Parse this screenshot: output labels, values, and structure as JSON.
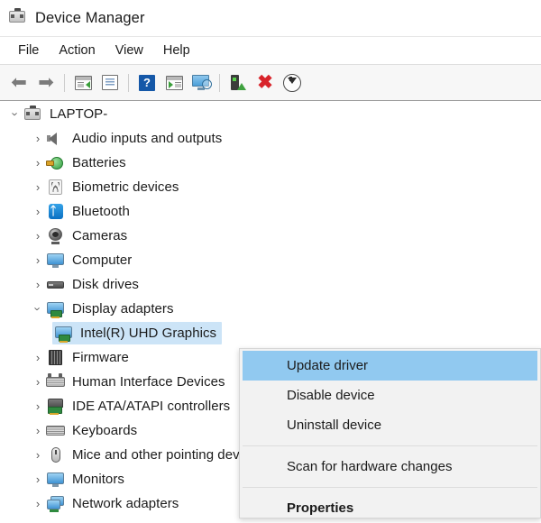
{
  "window": {
    "title": "Device Manager",
    "icon": "device-manager-icon"
  },
  "menubar": {
    "items": [
      {
        "label": "File"
      },
      {
        "label": "Action"
      },
      {
        "label": "View"
      },
      {
        "label": "Help"
      }
    ]
  },
  "toolbar": {
    "buttons": [
      {
        "name": "back-button",
        "icon": "back-arrow-icon",
        "glyph": "⬅"
      },
      {
        "name": "forward-button",
        "icon": "forward-arrow-icon",
        "glyph": "➡"
      },
      {
        "name": "show-hide-console-tree-button",
        "icon": "console-tree-icon"
      },
      {
        "name": "properties-button",
        "icon": "properties-icon"
      },
      {
        "name": "help-button",
        "icon": "help-icon",
        "glyph": "?"
      },
      {
        "name": "show-hide-action-pane-button",
        "icon": "action-pane-icon"
      },
      {
        "name": "scan-for-hardware-changes-button",
        "icon": "scan-monitor-icon"
      },
      {
        "name": "update-driver-button",
        "icon": "update-driver-icon"
      },
      {
        "name": "uninstall-device-button",
        "icon": "uninstall-x-icon",
        "glyph": "✖"
      },
      {
        "name": "disable-device-button",
        "icon": "disable-down-arrow-icon"
      }
    ]
  },
  "tree": {
    "root": {
      "label": "LAPTOP-",
      "icon": "computer-root-icon",
      "expanded": true,
      "chevron": "›"
    },
    "items": [
      {
        "label": "Audio inputs and outputs",
        "icon": "speaker-icon",
        "expanded": false,
        "indent": 1
      },
      {
        "label": "Batteries",
        "icon": "battery-icon",
        "expanded": false,
        "indent": 1
      },
      {
        "label": "Biometric devices",
        "icon": "fingerprint-icon",
        "expanded": false,
        "indent": 1
      },
      {
        "label": "Bluetooth",
        "icon": "bluetooth-icon",
        "expanded": false,
        "indent": 1
      },
      {
        "label": "Cameras",
        "icon": "camera-icon",
        "expanded": false,
        "indent": 1
      },
      {
        "label": "Computer",
        "icon": "monitor-icon",
        "expanded": false,
        "indent": 1
      },
      {
        "label": "Disk drives",
        "icon": "disk-drive-icon",
        "expanded": false,
        "indent": 1
      },
      {
        "label": "Display adapters",
        "icon": "display-adapter-icon",
        "expanded": true,
        "indent": 1
      },
      {
        "label": "Intel(R) UHD Graphics",
        "icon": "display-adapter-icon",
        "expanded": false,
        "indent": 2,
        "selected": true,
        "leaf": true
      },
      {
        "label": "Firmware",
        "icon": "firmware-icon",
        "expanded": false,
        "indent": 1
      },
      {
        "label": "Human Interface Devices",
        "icon": "hid-icon",
        "expanded": false,
        "indent": 1
      },
      {
        "label": "IDE ATA/ATAPI controllers",
        "icon": "ide-controller-icon",
        "expanded": false,
        "indent": 1
      },
      {
        "label": "Keyboards",
        "icon": "keyboard-icon",
        "expanded": false,
        "indent": 1
      },
      {
        "label": "Mice and other pointing devices",
        "icon": "mouse-icon",
        "expanded": false,
        "indent": 1
      },
      {
        "label": "Monitors",
        "icon": "monitor-icon",
        "expanded": false,
        "indent": 1
      },
      {
        "label": "Network adapters",
        "icon": "network-adapter-icon",
        "expanded": false,
        "indent": 1
      }
    ],
    "chevron_collapsed": "›",
    "chevron_expanded": "›"
  },
  "context_menu": {
    "items": [
      {
        "label": "Update driver",
        "highlighted": true,
        "bold": false
      },
      {
        "label": "Disable device",
        "highlighted": false,
        "bold": false
      },
      {
        "label": "Uninstall device",
        "highlighted": false,
        "bold": false
      },
      {
        "label": "Scan for hardware changes",
        "highlighted": false,
        "bold": false
      },
      {
        "label": "Properties",
        "highlighted": false,
        "bold": true
      }
    ]
  },
  "colors": {
    "selection_blue": "#cce4f7",
    "menu_highlight_blue": "#91c9f0",
    "menu_background": "#f2f2f2",
    "toolbar_background": "#f7f7f7",
    "uninstall_red": "#d8232a",
    "bluetooth_blue": "#0a6fc2"
  }
}
